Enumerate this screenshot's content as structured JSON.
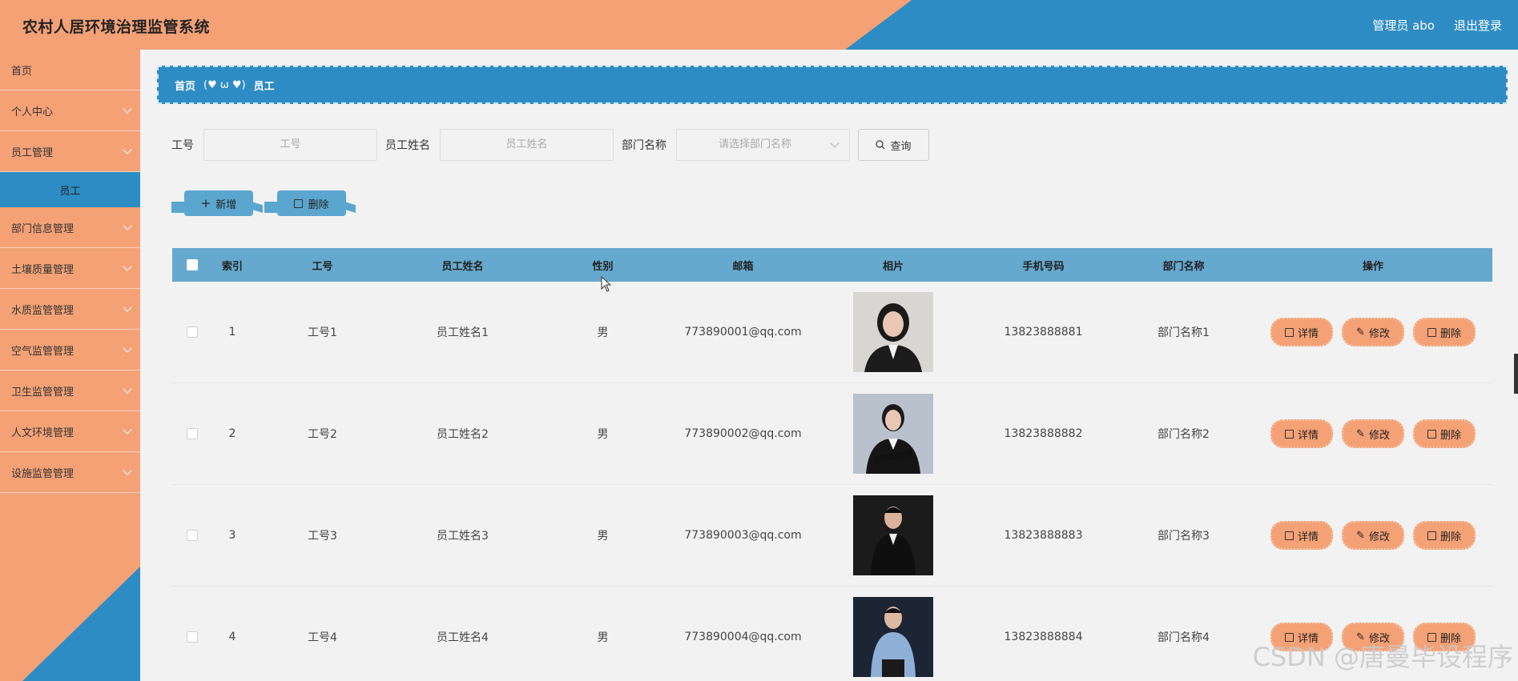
{
  "header": {
    "title": "农村人居环境治理监管系统",
    "user": "管理员 abo",
    "logout": "退出登录"
  },
  "sidebar": {
    "items": [
      {
        "label": "首页",
        "chevron": false
      },
      {
        "label": "个人中心",
        "chevron": true
      },
      {
        "label": "员工管理",
        "chevron": true
      },
      {
        "label": "部门信息管理",
        "chevron": true
      },
      {
        "label": "土壤质量管理",
        "chevron": true
      },
      {
        "label": "水质监管管理",
        "chevron": true
      },
      {
        "label": "空气监管管理",
        "chevron": true
      },
      {
        "label": "卫生监管管理",
        "chevron": true
      },
      {
        "label": "人文环境管理",
        "chevron": true
      },
      {
        "label": "设施监管管理",
        "chevron": true
      }
    ],
    "sub_item": "员工"
  },
  "breadcrumb": {
    "home": "首页",
    "sep": "(♥ ω ♥)",
    "current": "员工"
  },
  "search": {
    "no_label": "工号",
    "no_placeholder": "工号",
    "name_label": "员工姓名",
    "name_placeholder": "员工姓名",
    "dept_label": "部门名称",
    "dept_placeholder": "请选择部门名称",
    "query": "查询"
  },
  "actions": {
    "add": "新增",
    "delete": "删除"
  },
  "table": {
    "headers": [
      "索引",
      "工号",
      "员工姓名",
      "性别",
      "邮箱",
      "相片",
      "手机号码",
      "部门名称",
      "操作"
    ],
    "rows": [
      {
        "idx": "1",
        "no": "工号1",
        "name": "员工姓名1",
        "sex": "男",
        "mail": "773890001@qq.com",
        "phone": "13823888881",
        "dept": "部门名称1"
      },
      {
        "idx": "2",
        "no": "工号2",
        "name": "员工姓名2",
        "sex": "男",
        "mail": "773890002@qq.com",
        "phone": "13823888882",
        "dept": "部门名称2"
      },
      {
        "idx": "3",
        "no": "工号3",
        "name": "员工姓名3",
        "sex": "男",
        "mail": "773890003@qq.com",
        "phone": "13823888883",
        "dept": "部门名称3"
      },
      {
        "idx": "4",
        "no": "工号4",
        "name": "员工姓名4",
        "sex": "男",
        "mail": "773890004@qq.com",
        "phone": "13823888884",
        "dept": "部门名称4"
      }
    ],
    "ops": {
      "detail": "详情",
      "edit": "修改",
      "delete": "删除"
    }
  },
  "watermark": "CSDN @唐曼毕设程序",
  "colors": {
    "orange": "#f4a175",
    "blue": "#2e8cc4",
    "table_head": "#65a9ce"
  }
}
